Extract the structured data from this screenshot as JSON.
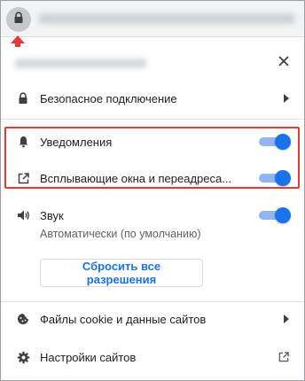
{
  "colors": {
    "accent": "#1a73e8",
    "toggle_track": "#93b4f2",
    "highlight_border": "#e53935",
    "secondary_text": "#5f6368"
  },
  "address_bar": {
    "lock_icon": "lock-icon",
    "pointer_icon": "up-arrow-icon"
  },
  "popup": {
    "close_icon": "close-icon",
    "connection": {
      "label": "Безопасное подключение",
      "icon": "lock-icon"
    },
    "notifications": {
      "label": "Уведомления",
      "icon": "bell-icon",
      "enabled": true
    },
    "popups": {
      "label": "Всплывающие окна и переадреса...",
      "icon": "open-in-new-icon",
      "enabled": true
    },
    "sound": {
      "label": "Звук",
      "sublabel": "Автоматически (по умолчанию)",
      "icon": "speaker-icon",
      "enabled": true
    },
    "reset_button": "Сбросить все разрешения",
    "cookies": {
      "label": "Файлы cookie и данные сайтов",
      "icon": "cookie-icon"
    },
    "site_settings": {
      "label": "Настройки сайтов",
      "icon": "gear-icon"
    }
  }
}
